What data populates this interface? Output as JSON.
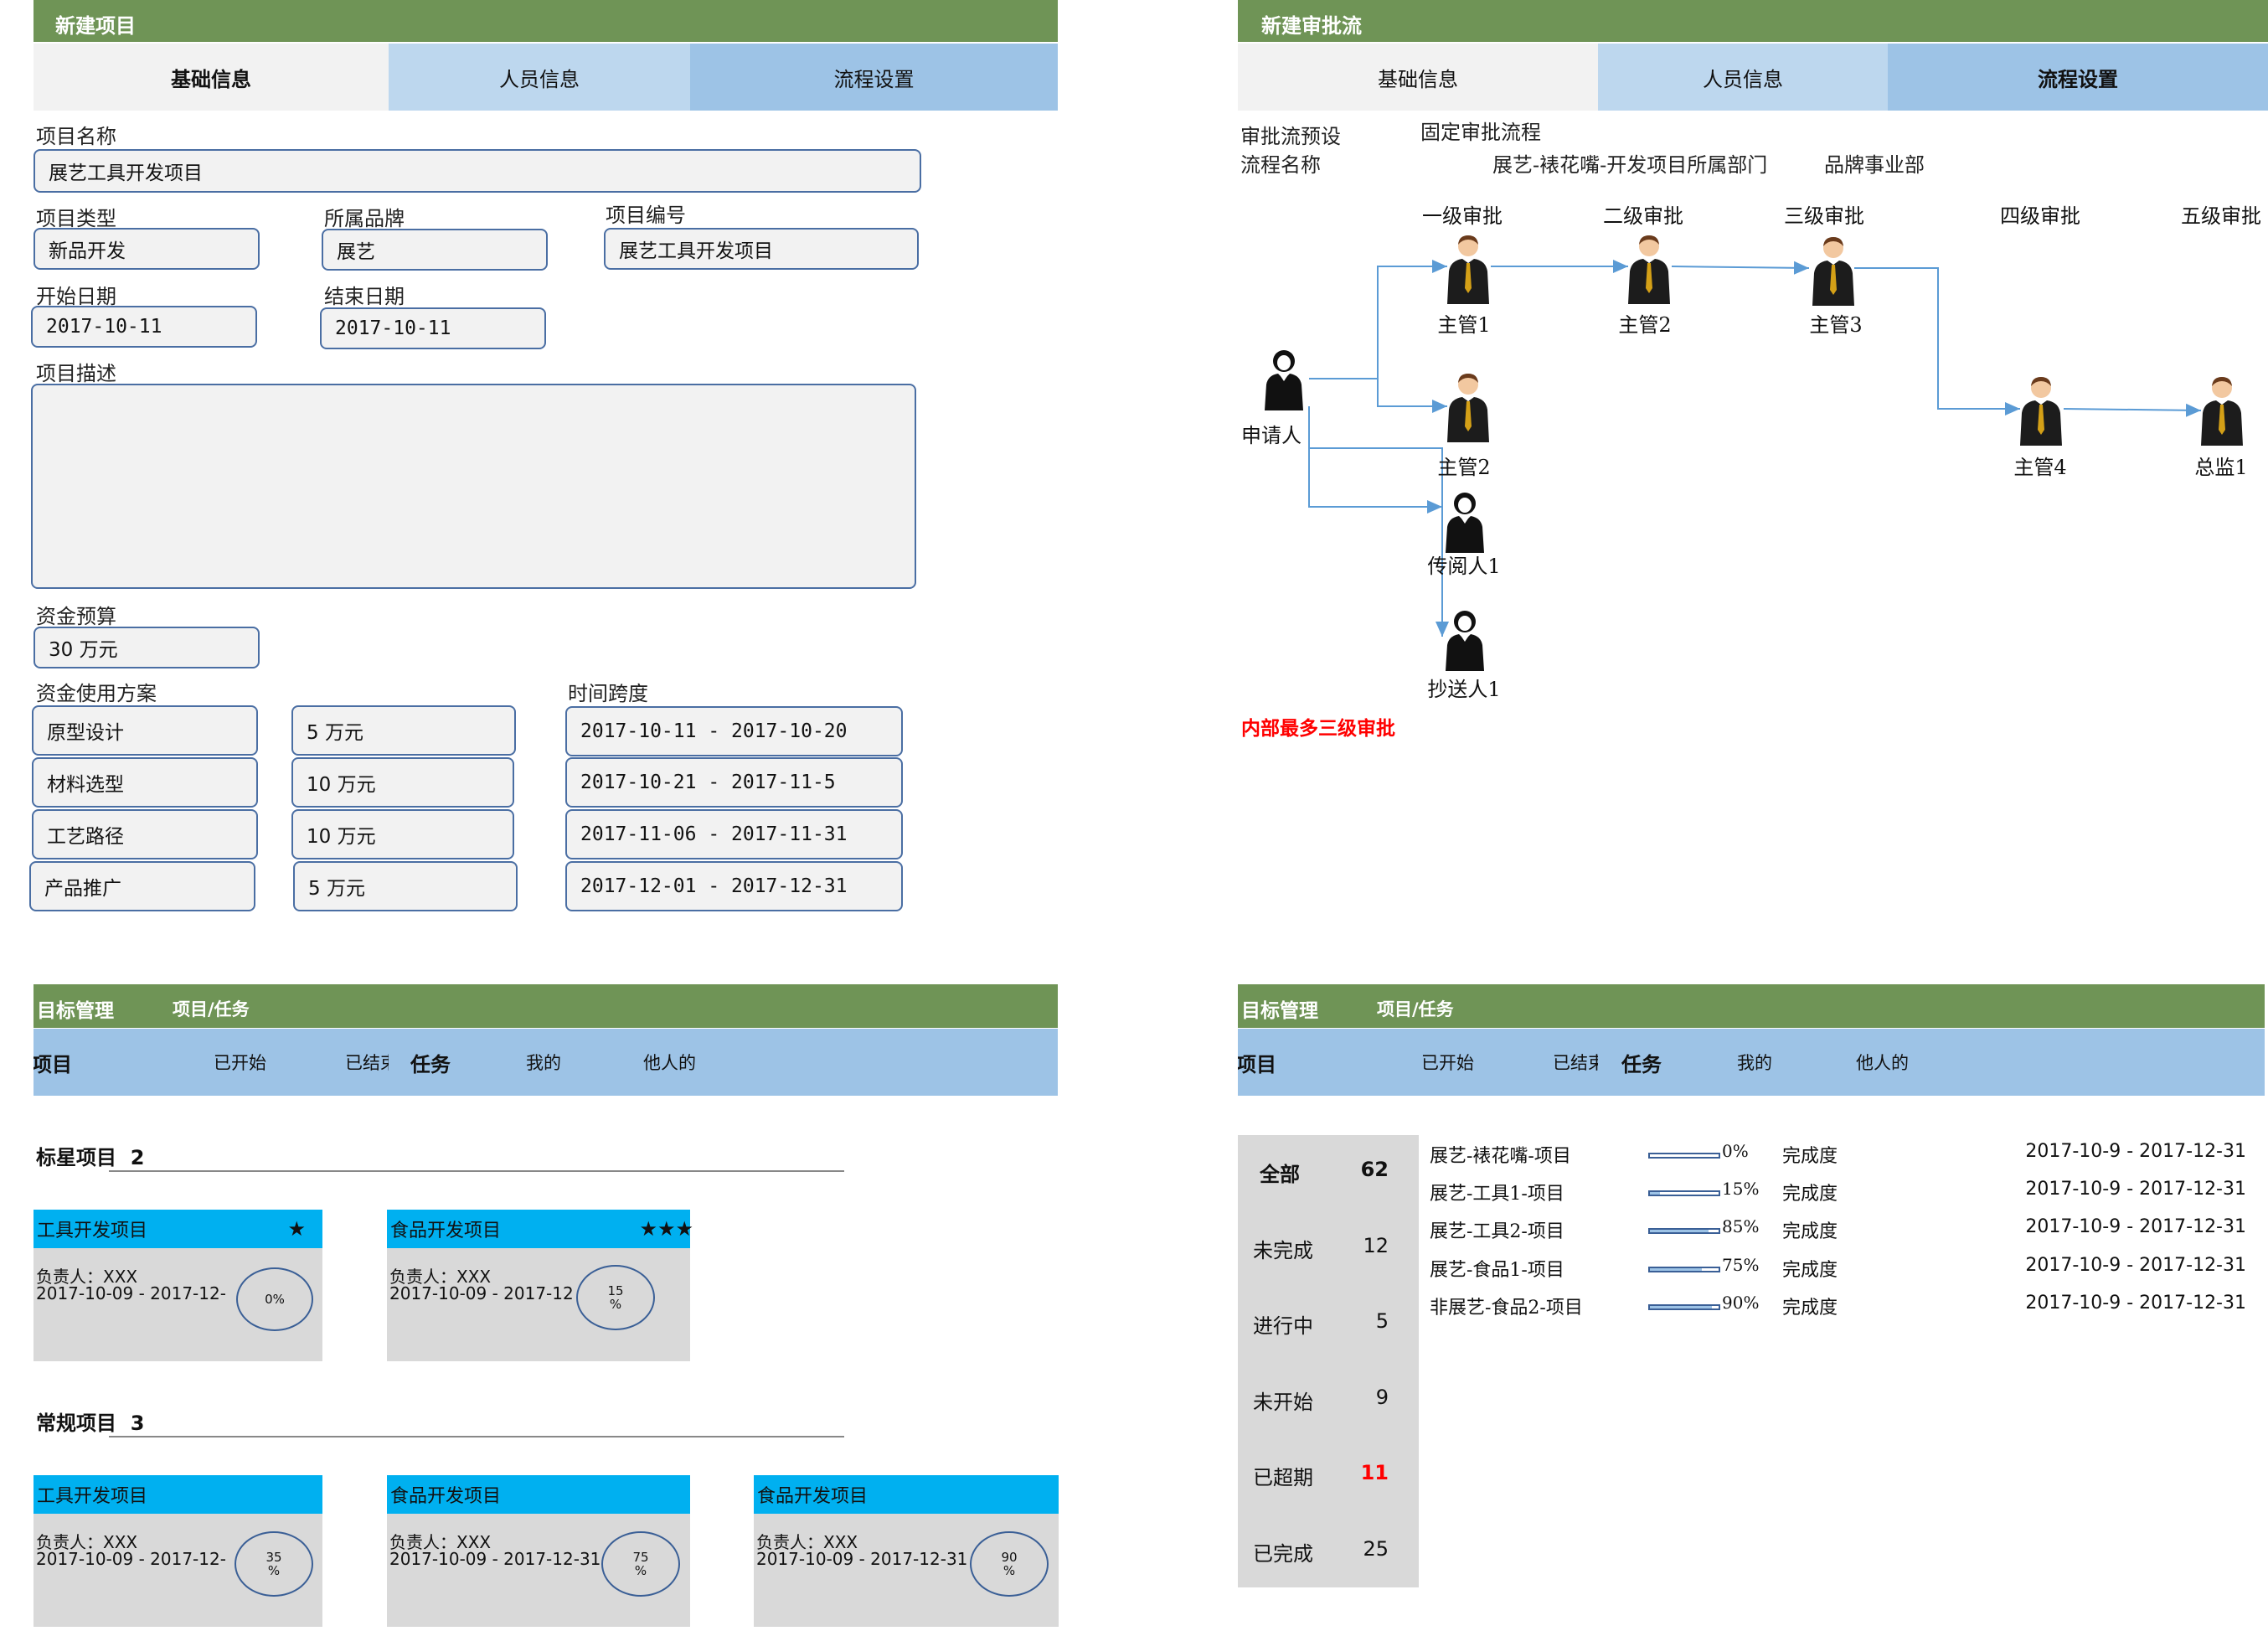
{
  "colors": {
    "header_green": "#6f9456",
    "tab_light": "#bdd7ee",
    "tab_mid": "#9dc3e6",
    "card_blue": "#00b0f0",
    "card_gray": "#d9d9d9",
    "alert_red": "#ff0000"
  },
  "new_project": {
    "title": "新建项目",
    "tabs": [
      "基础信息",
      "人员信息",
      "流程设置"
    ],
    "name_label": "项目名称",
    "name_value": "展艺工具开发项目",
    "type_label": "项目类型",
    "type_value": "新品开发",
    "brand_label": "所属品牌",
    "brand_value": "展艺",
    "code_label": "项目编号",
    "code_value": "展艺工具开发项目",
    "start_label": "开始日期",
    "start_value": "2017-10-11",
    "end_label": "结束日期",
    "end_value": "2017-10-11",
    "desc_label": "项目描述",
    "budget_label": "资金预算",
    "budget_value": "30 万元",
    "plan_label": "资金使用方案",
    "timespan_label": "时间跨度",
    "plan_rows": [
      {
        "item": "原型设计",
        "amount": "5 万元",
        "range": "2017-10-11 - 2017-10-20"
      },
      {
        "item": "材料选型",
        "amount": "10 万元",
        "range": "2017-10-21 - 2017-11-5"
      },
      {
        "item": "工艺路径",
        "amount": "10 万元",
        "range": "2017-11-06 - 2017-11-31"
      },
      {
        "item": "产品推广",
        "amount": "5 万元",
        "range": "2017-12-01 - 2017-12-31"
      }
    ]
  },
  "approval": {
    "title": "新建审批流",
    "tabs": [
      "基础信息",
      "人员信息",
      "流程设置"
    ],
    "preset_label": "审批流预设",
    "preset_value": "固定审批流程",
    "flow_name_label": "流程名称",
    "flow_name_value": "展艺-裱花嘴-开发项目所属部门",
    "flow_dept": "品牌事业部",
    "levels": [
      "一级审批",
      "二级审批",
      "三级审批",
      "四级审批",
      "五级审批"
    ],
    "people": {
      "applicant": "申请人",
      "m1": "主管1",
      "m2": "主管2",
      "m3": "主管3",
      "m2b": "主管2",
      "reader": "传阅人1",
      "cc": "抄送人1",
      "m4": "主管4",
      "director": "总监1"
    },
    "note": "内部最多三级审批"
  },
  "goals_left": {
    "title": "目标管理",
    "subtitle": "项目/任务",
    "tab_project": "项目",
    "tab_started": "已开始",
    "tab_ended": "已结束",
    "tab_task": "任务",
    "tab_mine": "我的",
    "tab_others": "他人的",
    "starred_heading": "标星项目",
    "starred_count": "2",
    "regular_heading": "常规项目",
    "regular_count": "3",
    "starred_cards": [
      {
        "name": "工具开发项目",
        "stars": "★",
        "owner": "负责人：XXX",
        "dates": "2017-10-09 - 2017-12-",
        "pct": "0%",
        "progress": 0
      },
      {
        "name": "食品开发项目",
        "stars": "★★★",
        "owner": "负责人：XXX",
        "dates": "2017-10-09 - 2017-12",
        "pct": "15\n%",
        "progress": 15
      }
    ],
    "regular_cards": [
      {
        "name": "工具开发项目",
        "owner": "负责人：XXX",
        "dates": "2017-10-09 - 2017-12-",
        "pct": "35\n%",
        "progress": 35
      },
      {
        "name": "食品开发项目",
        "owner": "负责人：XXX",
        "dates": "2017-10-09 - 2017-12-31",
        "pct": "75\n%",
        "progress": 75
      },
      {
        "name": "食品开发项目",
        "owner": "负责人：XXX",
        "dates": "2017-10-09 - 2017-12-31",
        "pct": "90\n%",
        "progress": 90
      }
    ]
  },
  "goals_right": {
    "title": "目标管理",
    "subtitle": "项目/任务",
    "tab_project": "项目",
    "tab_started": "已开始",
    "tab_ended": "已结束",
    "tab_task": "任务",
    "tab_mine": "我的",
    "tab_others": "他人的",
    "stats": [
      {
        "label": "全部",
        "value": "62",
        "bold": true,
        "red": false
      },
      {
        "label": "未完成",
        "value": "12",
        "bold": false,
        "red": false
      },
      {
        "label": "进行中",
        "value": "5",
        "bold": false,
        "red": false
      },
      {
        "label": "未开始",
        "value": "9",
        "bold": false,
        "red": false
      },
      {
        "label": "已超期",
        "value": "11",
        "bold": false,
        "red": true
      },
      {
        "label": "已完成",
        "value": "25",
        "bold": false,
        "red": false
      }
    ],
    "projects": [
      {
        "name": "展艺-裱花嘴-项目",
        "pct": "0%",
        "progress": 0,
        "status": "完成度",
        "range": "2017-10-9 - 2017-12-31"
      },
      {
        "name": "展艺-工具1-项目",
        "pct": "15%",
        "progress": 15,
        "status": "完成度",
        "range": "2017-10-9 - 2017-12-31"
      },
      {
        "name": "展艺-工具2-项目",
        "pct": "85%",
        "progress": 85,
        "status": "完成度",
        "range": "2017-10-9 - 2017-12-31"
      },
      {
        "name": "展艺-食品1-项目",
        "pct": "75%",
        "progress": 75,
        "status": "完成度",
        "range": "2017-10-9 - 2017-12-31"
      },
      {
        "name": "非展艺-食品2-项目",
        "pct": "90%",
        "progress": 90,
        "status": "完成度",
        "range": "2017-10-9 - 2017-12-31"
      }
    ]
  }
}
